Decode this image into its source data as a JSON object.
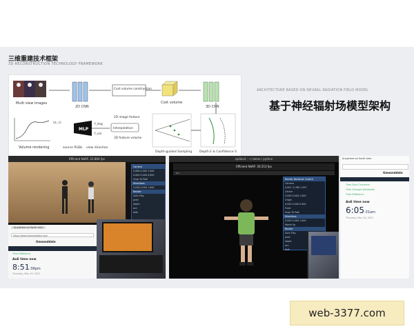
{
  "slide": {
    "title_cn": "三维重建技术框架",
    "title_en": "3D RECONSTRUCTION TECHNOLOGY FRAMEWORK",
    "heading_en": "ARCHITECTURE BASED ON NEURAL RADIATION FIELD MODEL",
    "heading_cn": "基于神经辐射场模型架构"
  },
  "diagram": {
    "multi_view": "Multi view images",
    "cnn_2d": "2D CNN",
    "cost_volume_construction": "Cost volume construction",
    "cost_volume": "Cost volume",
    "cnn_3d": "3D CNN",
    "feature_2d": "2D image feature",
    "feature_3d": "3D feature volume",
    "interpolation": "Interpolation",
    "mlp": "MLP",
    "source_rgbs": "source RGBs",
    "view_direction": "view direction",
    "volume_rendering": "Volume rendering",
    "depth_sampling": "Depth-guided Sampling",
    "depth_conf": "Depth E & Confidence S",
    "sigma_c": "(σ, c)",
    "f_img": "f_img",
    "f_vol": "f_vol"
  },
  "left_video": {
    "title": "Efficient NeRF: 22.864 fps",
    "panel_rows": [
      "Camera",
      "0.086  0.000  1.000",
      "0.000  0.000  0.000",
      "Snap To Path",
      "Directions",
      "0.046  0.000  1.000",
      "Render",
      "Auto Play",
      "pred",
      "depth",
      "acc",
      "blah"
    ],
    "browser_tab": "Anywhere on Earth time",
    "browser_url": "https://www.timeanddate.com",
    "browser_logo": "timeanddate",
    "time_diff_label": "Time Difference",
    "aoe_label": "AoE time now",
    "time": "8:51",
    "seconds": ":36",
    "ampm": "pm",
    "date": "Thursday, May 19, 2022"
  },
  "right_video": {
    "topbar": "zjuSkv4 : ~/ demo / python",
    "window_title": "Efficient NeRF: 26.513 fps",
    "menu": "File",
    "panel_rows": [
      "Render Backend: Cuda:0",
      "Camera",
      "0.001  -0.760  1.997",
      "Center",
      "0.000  0.000  1.000",
      "Origin",
      "0.000  0.000  0.000",
      "Front",
      "Snap To Path",
      "Directions",
      "0.000  0.000  1.000",
      "World Up",
      "Render",
      "Auto Play",
      "pred",
      "depth",
      "acc",
      "blah"
    ]
  },
  "side_browser": {
    "tab": "Anywhere on Earth time",
    "logo": "timeanddate",
    "link_1": "Time Zone Converter",
    "link_2": "Time Changes Worldwide",
    "link_3": "Time Difference",
    "aoe_label": "AoE time now",
    "time": "6:05",
    "seconds": ":31",
    "ampm": "am",
    "date": "Thursday, May 19, 2022"
  },
  "watermark": "web-3377.com",
  "colors": {
    "accent_blue": "#2e5e9e",
    "cnn_green": "#b9e3b0",
    "cnn_blue": "#9fc4e8",
    "cost_yellow": "#f2e27a",
    "watermark_bg": "#f7ecc0"
  }
}
